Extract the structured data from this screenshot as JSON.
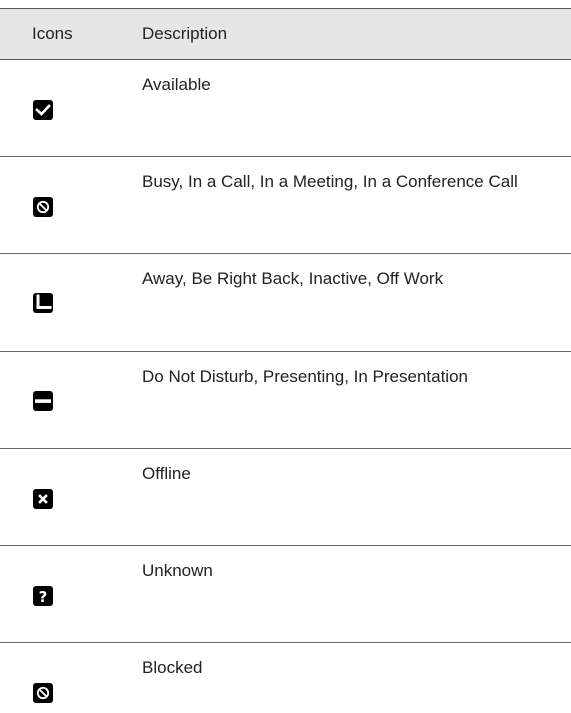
{
  "table": {
    "headers": {
      "icons": "Icons",
      "description": "Description"
    },
    "rows": [
      {
        "icon": "available-check-icon",
        "description": "Available"
      },
      {
        "icon": "busy-no-entry-icon",
        "description": "Busy, In a Call, In a Meeting, In a Conference Call"
      },
      {
        "icon": "away-clock-icon",
        "description": "Away, Be Right Back, Inactive, Off Work"
      },
      {
        "icon": "do-not-disturb-dash-icon",
        "description": "Do Not Disturb, Presenting, In Presentation"
      },
      {
        "icon": "offline-x-icon",
        "description": "Offline"
      },
      {
        "icon": "unknown-question-icon",
        "description": "Unknown"
      },
      {
        "icon": "blocked-no-entry-icon",
        "description": "Blocked"
      }
    ]
  }
}
